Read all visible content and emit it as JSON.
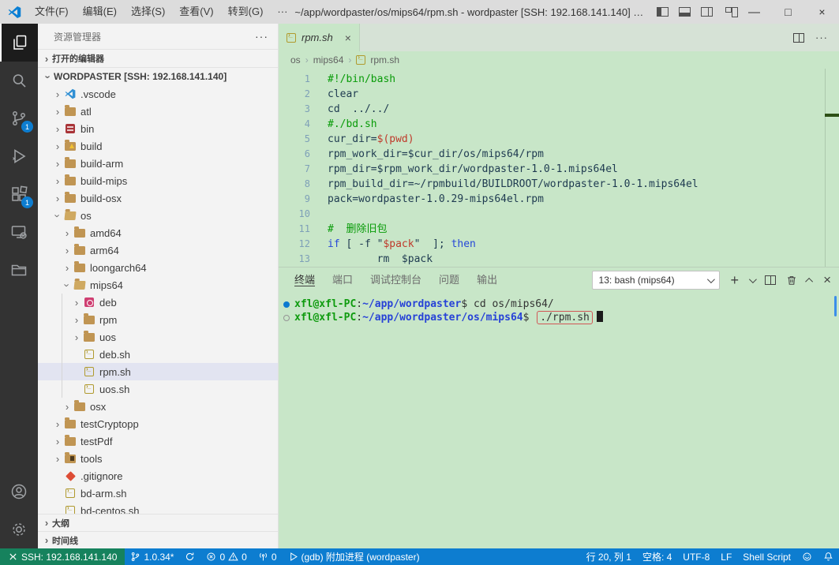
{
  "colors": {
    "accent": "#0d7dd0",
    "remote_green": "#16825d",
    "editor_bg": "#c8e6c8",
    "activity_bg": "#333333",
    "status_blue": "#0d7dd0"
  },
  "title_bar": {
    "menus": [
      "文件(F)",
      "编辑(E)",
      "选择(S)",
      "查看(V)",
      "转到(G)",
      "···"
    ],
    "title": "~/app/wordpaster/os/mips64/rpm.sh - wordpaster [SSH: 192.168.141.140] - ..."
  },
  "activity_bar": {
    "scm_badge": "1",
    "extensions_badge": "1"
  },
  "sidebar": {
    "title": "资源管理器",
    "more_actions": "···",
    "open_editors": "打开的编辑器",
    "outline": "大纲",
    "timeline": "时间线",
    "tree": [
      {
        "label": "WORDPASTER [SSH: 192.168.141.140]",
        "level": 0,
        "chevron": "v",
        "icon": "",
        "root": true
      },
      {
        "label": ".vscode",
        "level": 1,
        "chevron": ">",
        "icon": "vscode"
      },
      {
        "label": "atl",
        "level": 1,
        "chevron": ">",
        "icon": "folder"
      },
      {
        "label": "bin",
        "level": 1,
        "chevron": ">",
        "icon": "bin"
      },
      {
        "label": "build",
        "level": 1,
        "chevron": ">",
        "icon": "folder-build"
      },
      {
        "label": "build-arm",
        "level": 1,
        "chevron": ">",
        "icon": "folder"
      },
      {
        "label": "build-mips",
        "level": 1,
        "chevron": ">",
        "icon": "folder"
      },
      {
        "label": "build-osx",
        "level": 1,
        "chevron": ">",
        "icon": "folder"
      },
      {
        "label": "os",
        "level": 1,
        "chevron": "v",
        "icon": "folder-open"
      },
      {
        "label": "amd64",
        "level": 2,
        "chevron": ">",
        "icon": "folder"
      },
      {
        "label": "arm64",
        "level": 2,
        "chevron": ">",
        "icon": "folder"
      },
      {
        "label": "loongarch64",
        "level": 2,
        "chevron": ">",
        "icon": "folder"
      },
      {
        "label": "mips64",
        "level": 2,
        "chevron": "v",
        "icon": "folder-open"
      },
      {
        "label": "deb",
        "level": 3,
        "chevron": ">",
        "icon": "deb",
        "guide": true
      },
      {
        "label": "rpm",
        "level": 3,
        "chevron": ">",
        "icon": "folder",
        "guide": true
      },
      {
        "label": "uos",
        "level": 3,
        "chevron": ">",
        "icon": "folder",
        "guide": true
      },
      {
        "label": "deb.sh",
        "level": 3,
        "chevron": "",
        "icon": "shell",
        "guide": true
      },
      {
        "label": "rpm.sh",
        "level": 3,
        "chevron": "",
        "icon": "shell",
        "guide": true,
        "selected": true
      },
      {
        "label": "uos.sh",
        "level": 3,
        "chevron": "",
        "icon": "shell",
        "guide": true
      },
      {
        "label": "osx",
        "level": 2,
        "chevron": ">",
        "icon": "folder"
      },
      {
        "label": "testCryptopp",
        "level": 1,
        "chevron": ">",
        "icon": "folder"
      },
      {
        "label": "testPdf",
        "level": 1,
        "chevron": ">",
        "icon": "folder"
      },
      {
        "label": "tools",
        "level": 1,
        "chevron": ">",
        "icon": "folder-tools"
      },
      {
        "label": ".gitignore",
        "level": 1,
        "chevron": "",
        "icon": "git"
      },
      {
        "label": "bd-arm.sh",
        "level": 1,
        "chevron": "",
        "icon": "shell"
      },
      {
        "label": "bd-centos.sh",
        "level": 1,
        "chevron": "",
        "icon": "shell"
      }
    ]
  },
  "editor": {
    "tab": {
      "label": "rpm.sh",
      "close": "×"
    },
    "breadcrumb": [
      "os",
      "mips64",
      "rpm.sh"
    ],
    "lines": [
      {
        "n": "1",
        "seg": [
          [
            "c",
            "#!/bin/bash"
          ]
        ]
      },
      {
        "n": "2",
        "seg": [
          [
            "p",
            "clear"
          ]
        ]
      },
      {
        "n": "3",
        "seg": [
          [
            "p",
            "cd  ../../"
          ]
        ]
      },
      {
        "n": "4",
        "seg": [
          [
            "c",
            "#./bd.sh"
          ]
        ]
      },
      {
        "n": "5",
        "seg": [
          [
            "p",
            "cur_dir="
          ],
          [
            "r",
            "$(pwd)"
          ]
        ]
      },
      {
        "n": "6",
        "seg": [
          [
            "p",
            "rpm_work_dir=$cur_dir/os/mips64/rpm"
          ]
        ]
      },
      {
        "n": "7",
        "seg": [
          [
            "p",
            "rpm_dir=$rpm_work_dir/wordpaster-1.0-1.mips64el"
          ]
        ]
      },
      {
        "n": "8",
        "seg": [
          [
            "p",
            "rpm_build_dir=~/rpmbuild/BUILDROOT/wordpaster-1.0-1.mips64el"
          ]
        ]
      },
      {
        "n": "9",
        "seg": [
          [
            "p",
            "pack=wordpaster-1.0.29-mips64el.rpm"
          ]
        ]
      },
      {
        "n": "10",
        "seg": []
      },
      {
        "n": "11",
        "seg": [
          [
            "c",
            "#  删除旧包"
          ]
        ]
      },
      {
        "n": "12",
        "seg": [
          [
            "k",
            "if"
          ],
          [
            "p",
            " [ -f "
          ],
          [
            "p",
            "\""
          ],
          [
            "r",
            "$pack"
          ],
          [
            "p",
            "\""
          ],
          [
            "p",
            "  ]; "
          ],
          [
            "k",
            "then"
          ]
        ]
      },
      {
        "n": "13",
        "seg": [
          [
            "p",
            "        rm  $pack"
          ]
        ]
      }
    ]
  },
  "panel": {
    "tabs": [
      "终端",
      "端口",
      "调试控制台",
      "问题",
      "输出"
    ],
    "active_tab": "终端",
    "terminal_select": "13: bash (mips64)",
    "terminal": {
      "lines": [
        {
          "dec": "filled",
          "seg": [
            [
              "g",
              "xfl@xfl-PC"
            ],
            [
              "f",
              ":"
            ],
            [
              "b",
              "~/app/wordpaster"
            ],
            [
              "f",
              "$ "
            ],
            [
              "f",
              "cd os/mips64/"
            ]
          ]
        },
        {
          "dec": "hollow",
          "seg": [
            [
              "g",
              "xfl@xfl-PC"
            ],
            [
              "f",
              ":"
            ],
            [
              "b",
              "~/app/wordpaster/os/mips64"
            ],
            [
              "f",
              "$ "
            ],
            [
              "box",
              "./rpm.sh"
            ]
          ],
          "cursor": true
        }
      ]
    }
  },
  "status_bar": {
    "left": [
      {
        "name": "remote-indicator",
        "cls": "remote",
        "parts": [
          {
            "icon": "remote-icon"
          },
          {
            "text": "SSH: 192.168.141.140"
          }
        ]
      },
      {
        "name": "branch-status",
        "parts": [
          {
            "icon": "branch-icon"
          },
          {
            "text": "1.0.34*"
          }
        ]
      },
      {
        "name": "sync-status",
        "parts": [
          {
            "icon": "sync-icon"
          }
        ]
      },
      {
        "name": "problems-status",
        "parts": [
          {
            "icon": "error-icon"
          },
          {
            "text": "0"
          },
          {
            "icon": "warning-icon"
          },
          {
            "text": "0"
          }
        ]
      },
      {
        "name": "ports-status",
        "parts": [
          {
            "icon": "broadcast-icon"
          },
          {
            "text": "0"
          }
        ]
      },
      {
        "name": "debug-session",
        "parts": [
          {
            "icon": "debug-icon"
          },
          {
            "text": "(gdb) 附加进程 (wordpaster)"
          }
        ]
      }
    ],
    "right": [
      {
        "name": "cursor-position",
        "parts": [
          {
            "text": "行 20, 列 1"
          }
        ]
      },
      {
        "name": "indentation",
        "parts": [
          {
            "text": "空格: 4"
          }
        ]
      },
      {
        "name": "encoding",
        "parts": [
          {
            "text": "UTF-8"
          }
        ]
      },
      {
        "name": "eol",
        "parts": [
          {
            "text": "LF"
          }
        ]
      },
      {
        "name": "language-mode",
        "parts": [
          {
            "text": "Shell Script"
          }
        ]
      },
      {
        "name": "feedback",
        "parts": [
          {
            "icon": "feedback-icon"
          }
        ]
      },
      {
        "name": "notifications",
        "parts": [
          {
            "icon": "bell-icon"
          }
        ]
      }
    ]
  }
}
